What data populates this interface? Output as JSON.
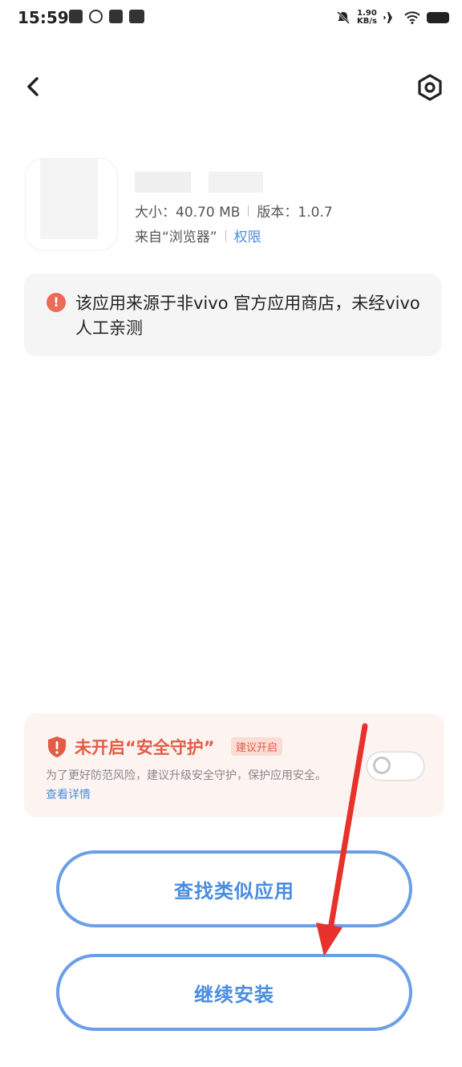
{
  "status_bar": {
    "time": "15:59",
    "net_speed_value": "1.90",
    "net_speed_unit": "KB/s",
    "icons": [
      "notification-icon",
      "app-icon",
      "message-icon",
      "vivo-icon",
      "mute-icon",
      "airplane-icon",
      "wifi-icon",
      "battery-icon"
    ]
  },
  "app": {
    "size_label": "大小：40.70 MB",
    "version_label": "版本：1.0.7",
    "source_label": "来自“浏览器”",
    "permission_link": "权限"
  },
  "warning": {
    "icon_glyph": "!",
    "text": "该应用来源于非vivo 官方应用商店，未经vivo人工亲测"
  },
  "security": {
    "title": "未开启“安全守护”",
    "badge": "建议开启",
    "description": "为了更好防范风险，建议升级安全守护，保护应用安全。",
    "details_link": "查看详情",
    "toggle_on": false
  },
  "buttons": {
    "find_similar": "查找类似应用",
    "continue_install": "继续安装"
  },
  "colors": {
    "accent": "#4a8ce0",
    "warning": "#ec6a57",
    "annotation_arrow": "#e8312a"
  }
}
